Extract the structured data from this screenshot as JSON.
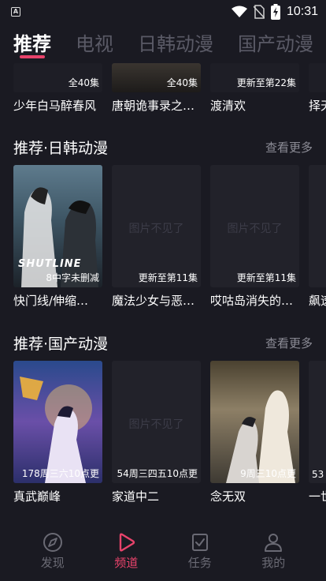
{
  "status_bar": {
    "time": "10:31",
    "app_icon_letter": "A"
  },
  "tabs": [
    {
      "label": "推荐",
      "active": true
    },
    {
      "label": "电视"
    },
    {
      "label": "日韩动漫"
    },
    {
      "label": "国产动漫"
    }
  ],
  "top_row": [
    {
      "title": "少年白马醉春风",
      "badge": "全40集"
    },
    {
      "title": "唐朝诡事录之…",
      "badge": "全40集"
    },
    {
      "title": "渡清欢",
      "badge": "更新至第22集"
    },
    {
      "title": "择天"
    }
  ],
  "section_jp": {
    "title": "推荐·日韩动漫",
    "more": "查看更多",
    "cards": [
      {
        "title": "快门线/伸缩…",
        "badge": "8中字未删减",
        "cover_text": "SHUTLINE"
      },
      {
        "title": "魔法少女与恶…",
        "badge": "更新至第11集",
        "missing": "图片不见了"
      },
      {
        "title": "哎咕岛消失的…",
        "badge": "更新至第11集",
        "missing": "图片不见了"
      },
      {
        "title": "飙速"
      }
    ]
  },
  "section_cn": {
    "title": "推荐·国产动漫",
    "more": "查看更多",
    "cards": [
      {
        "title": "真武巅峰",
        "badge": "178周三六10点更"
      },
      {
        "title": "家道中二",
        "badge": "54周三四五10点更",
        "missing": "图片不见了"
      },
      {
        "title": "念无双",
        "badge": "9周三10点更"
      },
      {
        "title": "一世",
        "badge": "53"
      }
    ]
  },
  "bottom_nav": [
    {
      "label": "发现",
      "icon": "compass-icon"
    },
    {
      "label": "频道",
      "icon": "play-icon",
      "active": true
    },
    {
      "label": "任务",
      "icon": "task-icon"
    },
    {
      "label": "我的",
      "icon": "user-icon"
    }
  ],
  "colors": {
    "accent": "#e8436b",
    "background": "#1a1a22"
  }
}
